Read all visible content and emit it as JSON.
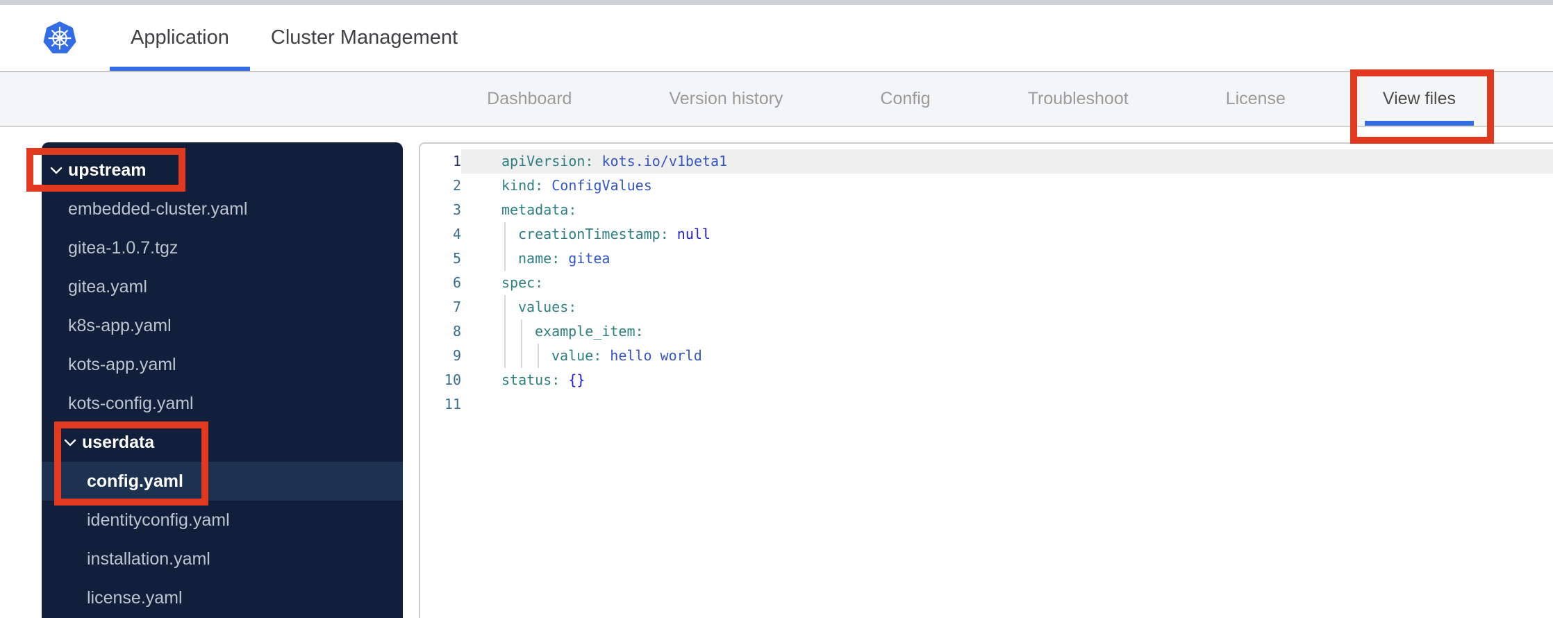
{
  "header": {
    "logo": "kubernetes-logo",
    "tabs": [
      {
        "label": "Application",
        "active": true
      },
      {
        "label": "Cluster Management",
        "active": false
      }
    ]
  },
  "nav": {
    "tabs": [
      {
        "label": "Dashboard",
        "active": false
      },
      {
        "label": "Version history",
        "active": false
      },
      {
        "label": "Config",
        "active": false
      },
      {
        "label": "Troubleshoot",
        "active": false
      },
      {
        "label": "License",
        "active": false
      },
      {
        "label": "View files",
        "active": true
      }
    ]
  },
  "file_tree": {
    "items": [
      {
        "label": "upstream",
        "type": "folder",
        "level": 0,
        "expanded": true
      },
      {
        "label": "embedded-cluster.yaml",
        "type": "file",
        "level": 1
      },
      {
        "label": "gitea-1.0.7.tgz",
        "type": "file",
        "level": 1
      },
      {
        "label": "gitea.yaml",
        "type": "file",
        "level": 1
      },
      {
        "label": "k8s-app.yaml",
        "type": "file",
        "level": 1
      },
      {
        "label": "kots-app.yaml",
        "type": "file",
        "level": 1
      },
      {
        "label": "kots-config.yaml",
        "type": "file",
        "level": 1
      },
      {
        "label": "userdata",
        "type": "folder",
        "level": 1,
        "expanded": true
      },
      {
        "label": "config.yaml",
        "type": "file",
        "level": 2,
        "selected": true
      },
      {
        "label": "identityconfig.yaml",
        "type": "file",
        "level": 2
      },
      {
        "label": "installation.yaml",
        "type": "file",
        "level": 2
      },
      {
        "label": "license.yaml",
        "type": "file",
        "level": 2
      }
    ]
  },
  "editor": {
    "active_line": 1,
    "lines": [
      {
        "num": 1,
        "indent": 0,
        "tokens": [
          [
            "key",
            "apiVersion:"
          ],
          [
            "val",
            " kots.io/v1beta1"
          ]
        ]
      },
      {
        "num": 2,
        "indent": 0,
        "tokens": [
          [
            "key",
            "kind:"
          ],
          [
            "val",
            " ConfigValues"
          ]
        ]
      },
      {
        "num": 3,
        "indent": 0,
        "tokens": [
          [
            "key",
            "metadata:"
          ]
        ]
      },
      {
        "num": 4,
        "indent": 2,
        "tokens": [
          [
            "key",
            "creationTimestamp:"
          ],
          [
            "atom",
            " null"
          ]
        ]
      },
      {
        "num": 5,
        "indent": 2,
        "tokens": [
          [
            "key",
            "name:"
          ],
          [
            "val",
            " gitea"
          ]
        ]
      },
      {
        "num": 6,
        "indent": 0,
        "tokens": [
          [
            "key",
            "spec:"
          ]
        ]
      },
      {
        "num": 7,
        "indent": 2,
        "tokens": [
          [
            "key",
            "values:"
          ]
        ]
      },
      {
        "num": 8,
        "indent": 4,
        "tokens": [
          [
            "key",
            "example_item:"
          ]
        ]
      },
      {
        "num": 9,
        "indent": 6,
        "tokens": [
          [
            "key",
            "value:"
          ],
          [
            "val",
            " hello world"
          ]
        ]
      },
      {
        "num": 10,
        "indent": 0,
        "tokens": [
          [
            "key",
            "status:"
          ],
          [
            "atom",
            " {}"
          ]
        ]
      },
      {
        "num": 11,
        "indent": 0,
        "tokens": []
      }
    ]
  },
  "annotations": [
    {
      "target": "view-files-tab"
    },
    {
      "target": "upstream-folder"
    },
    {
      "target": "userdata-and-config-yaml"
    }
  ],
  "colors": {
    "accent_blue": "#326de6",
    "annotation_red": "#e0391f",
    "sidebar_bg": "#121f3a",
    "sidebar_selected_bg": "#1d3150",
    "code_key": "#2e7f80",
    "code_value": "#3356c2",
    "code_atom": "#1b1be6",
    "line_number": "#3a6e8e",
    "active_line_number": "#27306b"
  }
}
